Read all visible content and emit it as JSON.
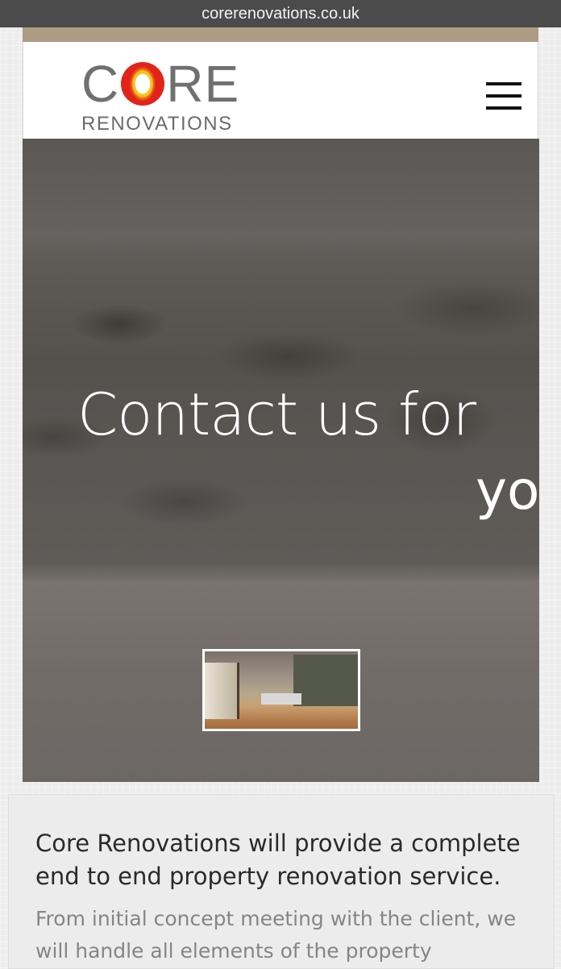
{
  "browser": {
    "url": "corerenovations.co.uk"
  },
  "header": {
    "logo": {
      "core_text": [
        "C",
        "O",
        "R",
        "E"
      ],
      "sub_text": "RENOVATIONS"
    },
    "menu_icon": "hamburger-icon"
  },
  "hero": {
    "title": "Contact us for",
    "subtitle": "yo"
  },
  "info": {
    "lead": "Core Renovations will provide a complete end to end property renovation service.",
    "body": "From initial concept meeting with the client, we will handle all elements of the property"
  },
  "colors": {
    "url_bar": "#4b4b4b",
    "accent_strip": "#ad9b83",
    "logo_grey": "#707070",
    "logo_red": "#e2231a",
    "logo_orange": "#ef7d16",
    "logo_yellow": "#f6c21b"
  }
}
